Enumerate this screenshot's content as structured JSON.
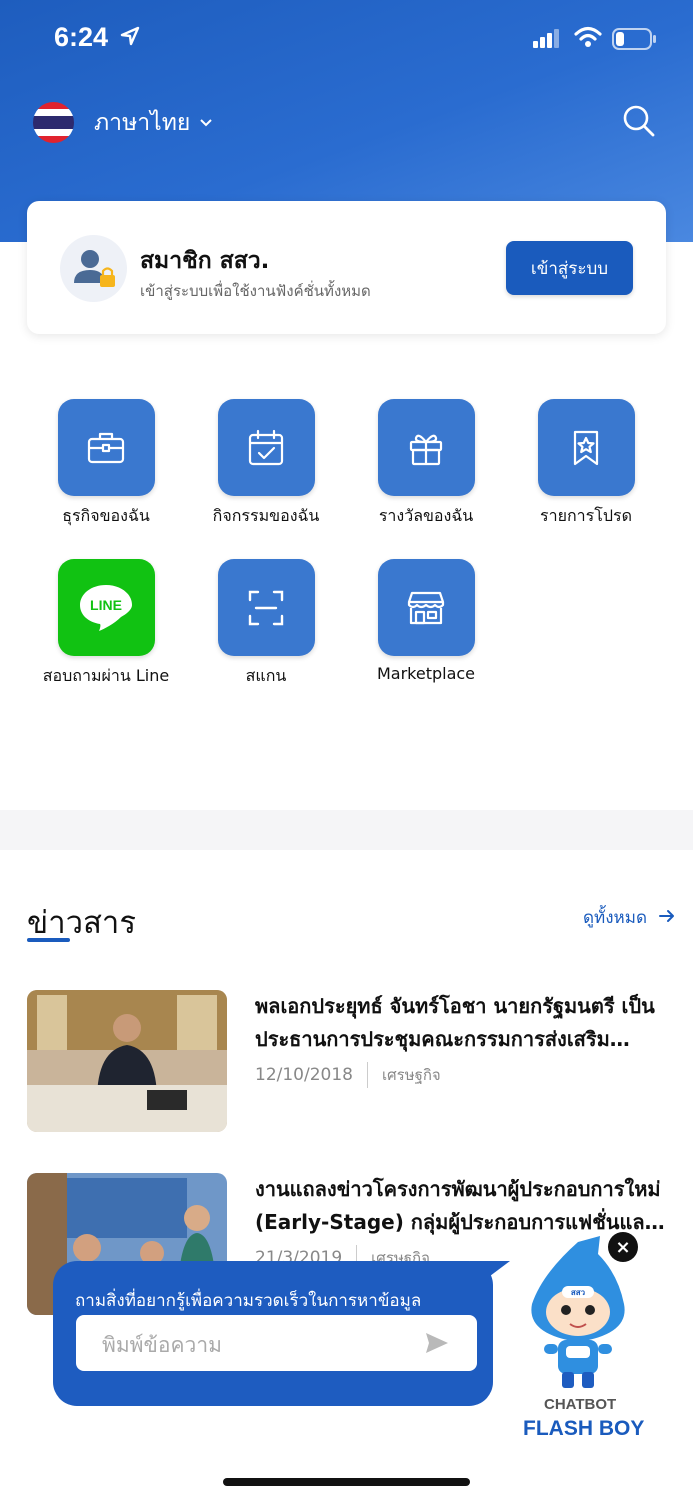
{
  "status_bar": {
    "time": "6:24"
  },
  "header": {
    "language_label": "ภาษาไทย"
  },
  "member_card": {
    "title": "สมาชิก สสว.",
    "subtitle": "เข้าสู่ระบบเพื่อใช้งานฟังค์ชั่นทั้งหมด",
    "login_label": "เข้าสู่ระบบ"
  },
  "menu": {
    "items": [
      {
        "label": "ธุรกิจของฉัน",
        "icon": "briefcase-icon"
      },
      {
        "label": "กิจกรรมของฉัน",
        "icon": "calendar-check-icon"
      },
      {
        "label": "รางวัลของฉัน",
        "icon": "gift-icon"
      },
      {
        "label": "รายการโปรด",
        "icon": "bookmark-star-icon"
      },
      {
        "label": "สอบถามผ่าน Line",
        "icon": "line-icon",
        "icon_text": "LINE"
      },
      {
        "label": "สแกน",
        "icon": "scan-icon"
      },
      {
        "label": "Marketplace",
        "icon": "store-icon"
      }
    ]
  },
  "news": {
    "title": "ข่าวสาร",
    "see_all_label": "ดูทั้งหมด",
    "items": [
      {
        "headline": "พลเอกประยุทธ์ จันทร์โอชา นายกรัฐมนตรี เป็นประธานการประชุมคณะกรรมการส่งเสริมวิสาหกิจขนาดกลางและขนาดย่อม",
        "date": "12/10/2018",
        "category": "เศรษฐกิจ"
      },
      {
        "headline": "งานแถลงข่าวโครงการพัฒนาผู้ประกอบการใหม่ (Early-Stage) กลุ่มผู้ประกอบการแฟชั่นและไลฟ์สไตล์",
        "date": "21/3/2019",
        "category": "เศรษฐกิจ"
      }
    ]
  },
  "chatbot": {
    "prompt": "ถามสิ่งที่อยากรู้เพื่อความรวดเร็วในการหาข้อมูล",
    "placeholder": "พิมพ์ข้อความ",
    "label_top": "CHATBOT",
    "label_bottom": "FLASH BOY",
    "badge_text": "สสว"
  },
  "colors": {
    "brand_blue": "#1a5bbd",
    "menu_icon_bg": "#3a78cf",
    "line_green": "#11c212"
  }
}
